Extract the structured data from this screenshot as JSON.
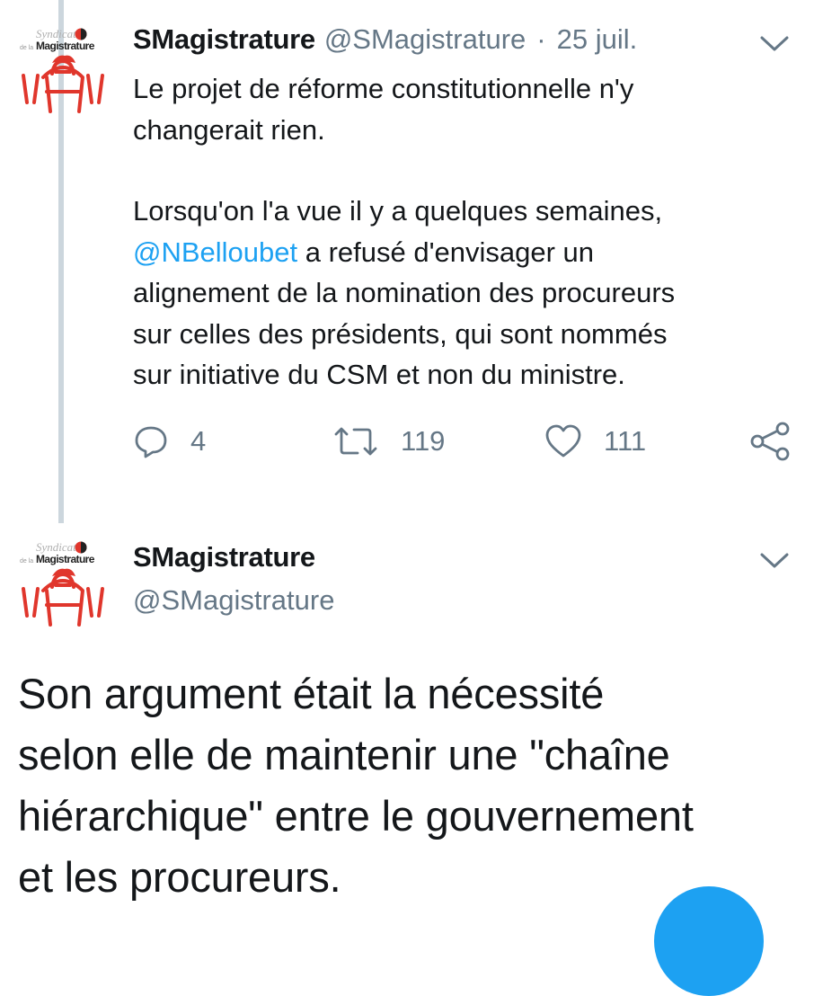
{
  "thread": {
    "tweet1": {
      "avatar": {
        "logo_text_top": "Syndicat",
        "logo_text_main": "de la Magistrature",
        "accent": "#e0362c"
      },
      "display_name": "SMagistrature",
      "handle": "@SMagistrature",
      "separator": "·",
      "date": "25 juil.",
      "text_lines_p1": [
        "Le projet de réforme constitutionnelle n'y",
        "changerait rien."
      ],
      "text_p2_line1": "Lorsqu'on l'a vue il y a quelques semaines,",
      "mention": "@NBelloubet",
      "text_p2_line2_rest": " a refusé d'envisager un",
      "text_p2_line3": "alignement de la nomination des procureurs",
      "text_p2_line4": "sur celles des présidents, qui sont nommés",
      "text_p2_line5": "sur initiative du CSM et non du ministre.",
      "actions": {
        "reply": {
          "icon": "reply-icon",
          "count": "4"
        },
        "retweet": {
          "icon": "retweet-icon",
          "count": "119"
        },
        "like": {
          "icon": "heart-icon",
          "count": "111"
        },
        "share": {
          "icon": "share-icon"
        }
      }
    },
    "tweet2": {
      "display_name": "SMagistrature",
      "handle": "@SMagistrature",
      "text_lines": [
        "Son argument était la nécessité",
        "selon elle de maintenir une \"chaîne",
        "hiérarchique\" entre le gouvernement",
        "et les procureurs."
      ]
    }
  },
  "colors": {
    "text": "#14171a",
    "secondary": "#657786",
    "link": "#1da1f2",
    "thread_line": "#ccd6dd",
    "compose_button": "#1da1f2"
  }
}
